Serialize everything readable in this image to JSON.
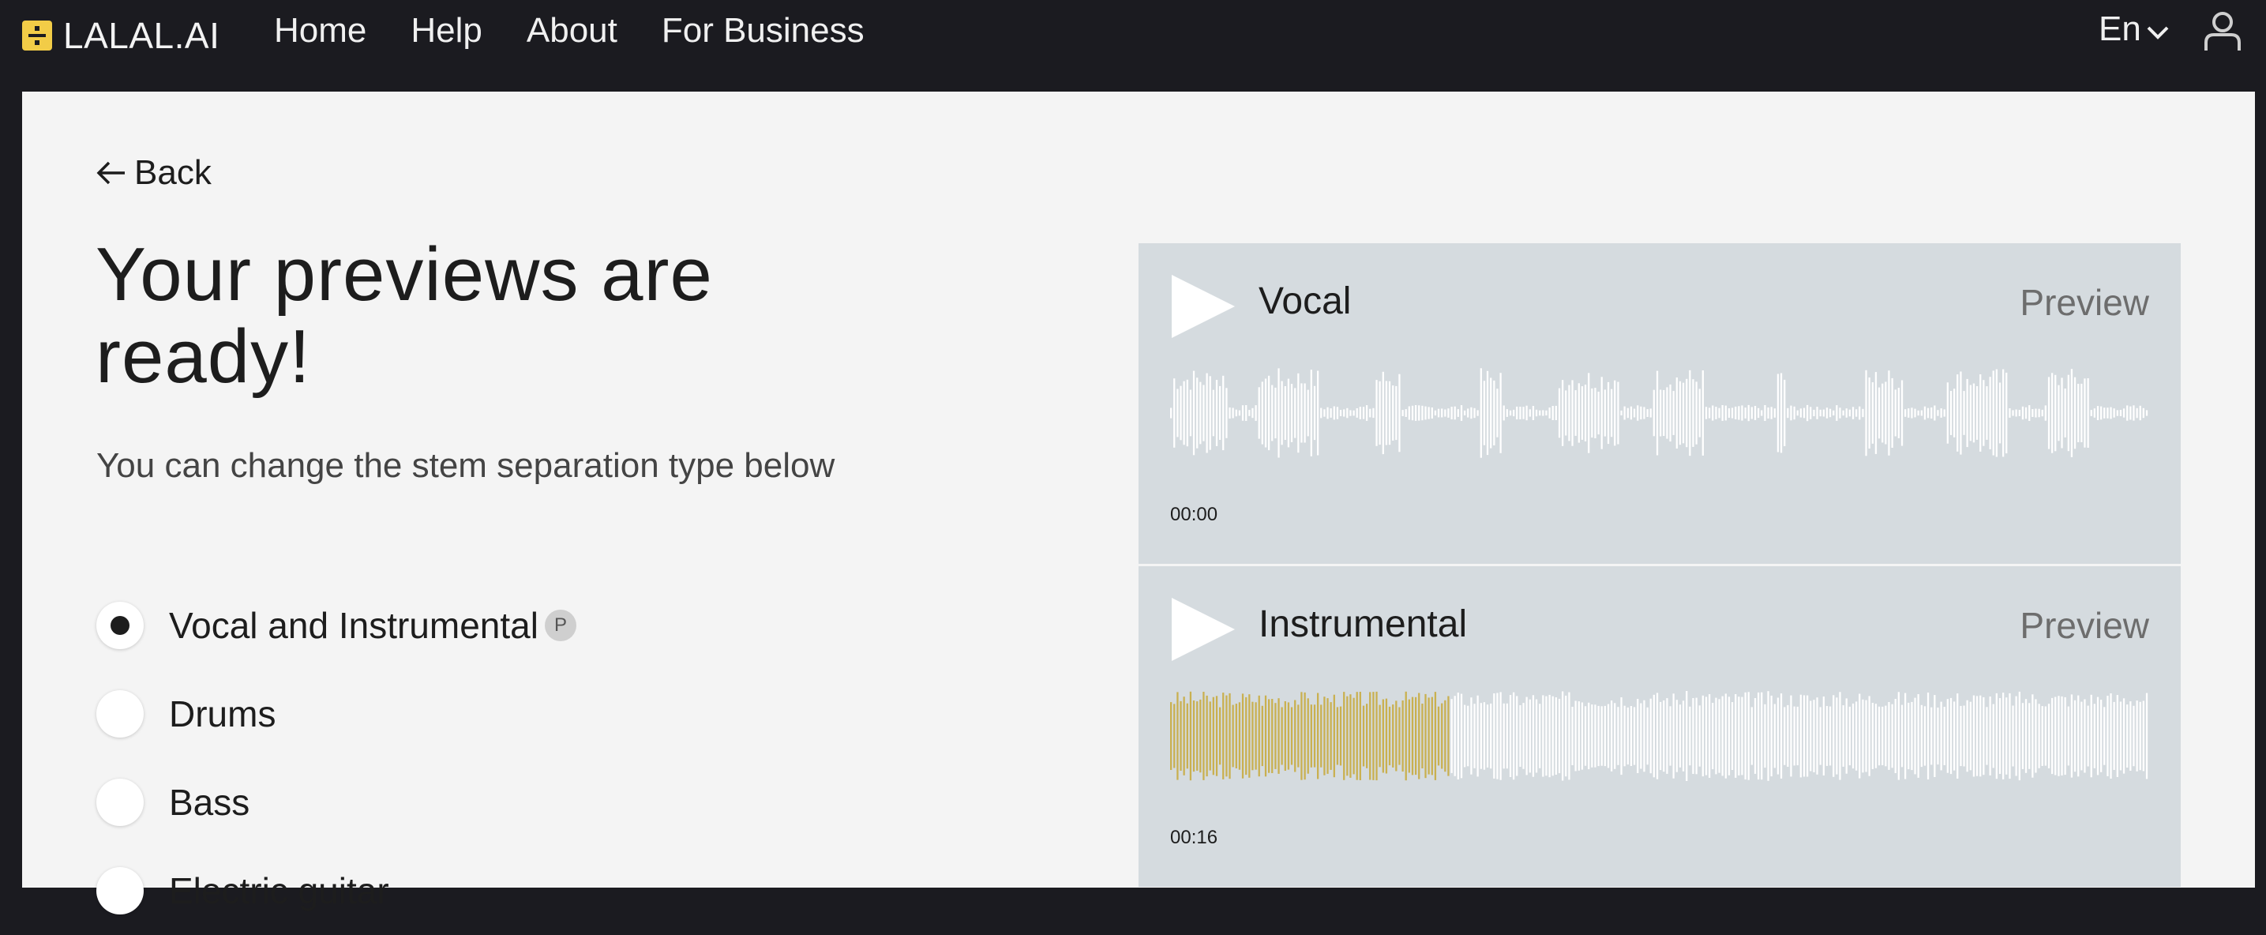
{
  "header": {
    "logo_text": "LALAL.AI",
    "nav": [
      "Home",
      "Help",
      "About",
      "For Business"
    ],
    "language": "En",
    "brand_color": "#f2cc47"
  },
  "main": {
    "back_label": "Back",
    "title": "Your previews are ready!",
    "subtitle": "You can change the stem separation type below",
    "options": [
      {
        "label": "Vocal and Instrumental",
        "selected": true,
        "badge": "P"
      },
      {
        "label": "Drums",
        "selected": false
      },
      {
        "label": "Bass",
        "selected": false
      },
      {
        "label": "Electric guitar",
        "selected": false
      }
    ]
  },
  "tracks": [
    {
      "name": "Vocal",
      "action": "Preview",
      "time": "00:00",
      "progress": 0.0
    },
    {
      "name": "Instrumental",
      "action": "Preview",
      "time": "00:16",
      "progress": 0.285
    }
  ],
  "colors": {
    "played": "#c9b050",
    "unplayed": "#ffffff"
  }
}
